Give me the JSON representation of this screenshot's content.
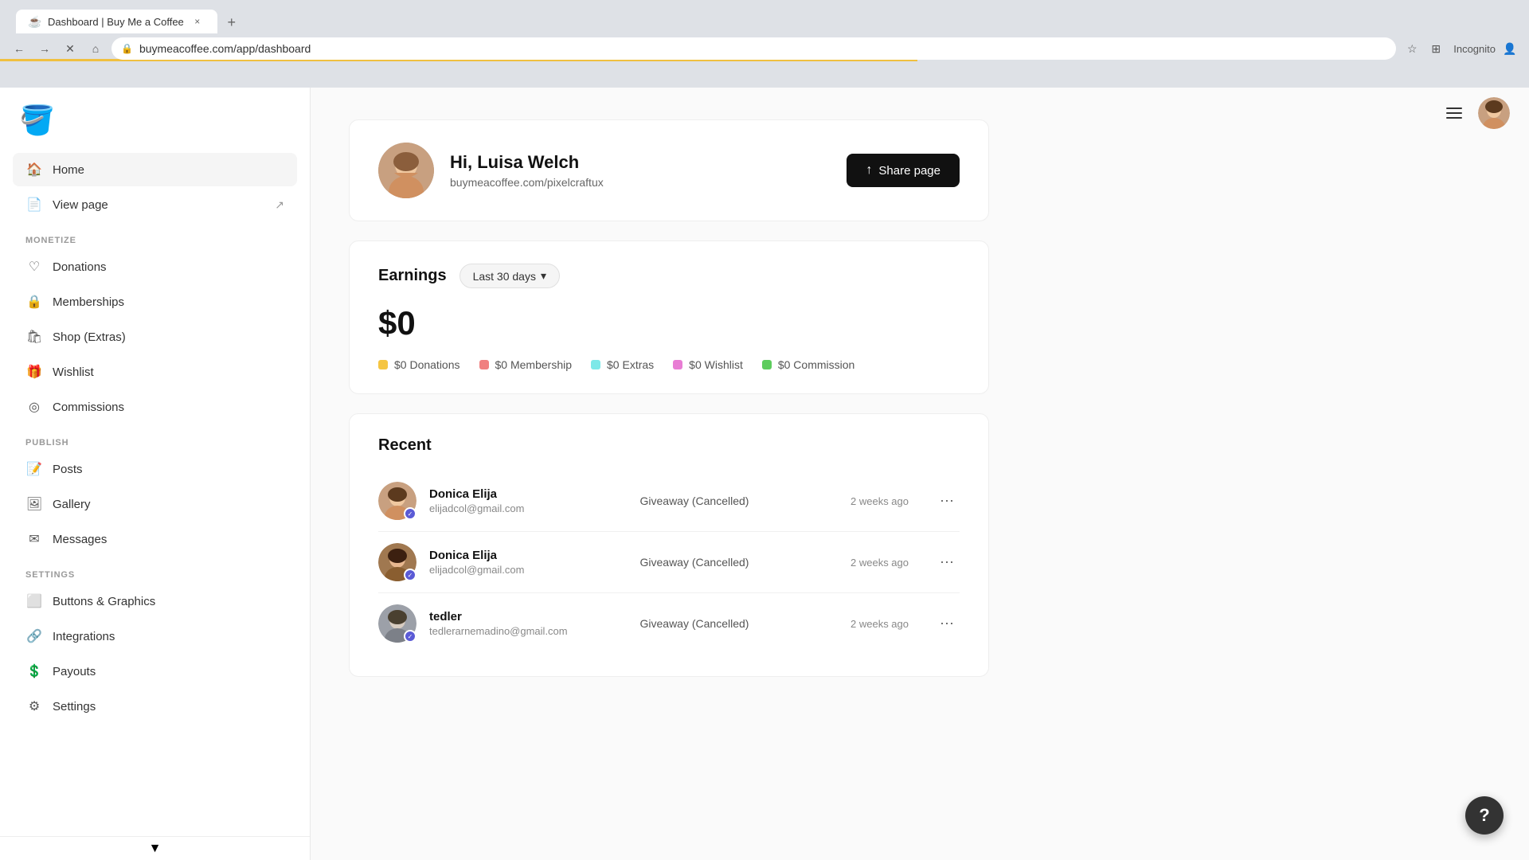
{
  "browser": {
    "tab_title": "Dashboard | Buy Me a Coffee",
    "tab_favicon": "☕",
    "url": "buymeacoffee.com/app/dashboard",
    "new_tab_label": "+",
    "close_tab": "×",
    "nav_back": "←",
    "nav_forward": "→",
    "nav_reload": "✕",
    "nav_home": "⌂",
    "bookmark_icon": "☆",
    "incognito_label": "Incognito"
  },
  "sidebar": {
    "logo_emoji": "🪣",
    "nav_items": [
      {
        "id": "home",
        "label": "Home",
        "icon": "🏠",
        "active": true
      },
      {
        "id": "view-page",
        "label": "View page",
        "icon": "📄",
        "external": true
      }
    ],
    "sections": [
      {
        "label": "MONETIZE",
        "items": [
          {
            "id": "donations",
            "label": "Donations",
            "icon": "♡"
          },
          {
            "id": "memberships",
            "label": "Memberships",
            "icon": "🔒"
          },
          {
            "id": "shop-extras",
            "label": "Shop (Extras)",
            "icon": "🛍"
          },
          {
            "id": "wishlist",
            "label": "Wishlist",
            "icon": "🎁"
          },
          {
            "id": "commissions",
            "label": "Commissions",
            "icon": "◎"
          }
        ]
      },
      {
        "label": "PUBLISH",
        "items": [
          {
            "id": "posts",
            "label": "Posts",
            "icon": "📝"
          },
          {
            "id": "gallery",
            "label": "Gallery",
            "icon": "🖼"
          },
          {
            "id": "messages",
            "label": "Messages",
            "icon": "✉"
          }
        ]
      },
      {
        "label": "SETTINGS",
        "items": [
          {
            "id": "buttons-graphics",
            "label": "Buttons & Graphics",
            "icon": "⬜"
          },
          {
            "id": "integrations",
            "label": "Integrations",
            "icon": "🔗"
          },
          {
            "id": "payouts",
            "label": "Payouts",
            "icon": "💲"
          },
          {
            "id": "settings",
            "label": "Settings",
            "icon": "⚙"
          }
        ]
      }
    ]
  },
  "header": {
    "greeting": "Hi, Luisa Welch",
    "profile_url": "buymeacoffee.com/pixelcraftux",
    "share_page_label": "Share page",
    "share_icon": "↑"
  },
  "earnings": {
    "title": "Earnings",
    "period": "Last 30 days",
    "period_icon": "▾",
    "amount": "$0",
    "breakdown": [
      {
        "label": "$0 Donations",
        "color": "#f5c542"
      },
      {
        "label": "$0 Membership",
        "color": "#f08080"
      },
      {
        "label": "$0 Extras",
        "color": "#7de8e8"
      },
      {
        "label": "$0 Wishlist",
        "color": "#e87dd4"
      },
      {
        "label": "$0 Commission",
        "color": "#5dcc5d"
      }
    ]
  },
  "recent": {
    "title": "Recent",
    "items": [
      {
        "name": "Donica Elija",
        "email": "elijadcol@gmail.com",
        "status": "Giveaway (Cancelled)",
        "time": "2 weeks ago",
        "avatar_color": "#c8a08a",
        "badge_color": "#5b5bd6"
      },
      {
        "name": "Donica Elija",
        "email": "elijadcol@gmail.com",
        "status": "Giveaway (Cancelled)",
        "time": "2 weeks ago",
        "avatar_color": "#a07850",
        "badge_color": "#5b5bd6"
      },
      {
        "name": "tedler",
        "email": "tedlerarnemadino@gmail.com",
        "status": "Giveaway (Cancelled)",
        "time": "2 weeks ago",
        "avatar_color": "#9ca0a8",
        "badge_color": "#5b5bd6"
      }
    ]
  },
  "help": {
    "label": "?"
  },
  "topbar": {
    "menu_label": "☰",
    "user_avatar_color": "#c8a08a"
  }
}
